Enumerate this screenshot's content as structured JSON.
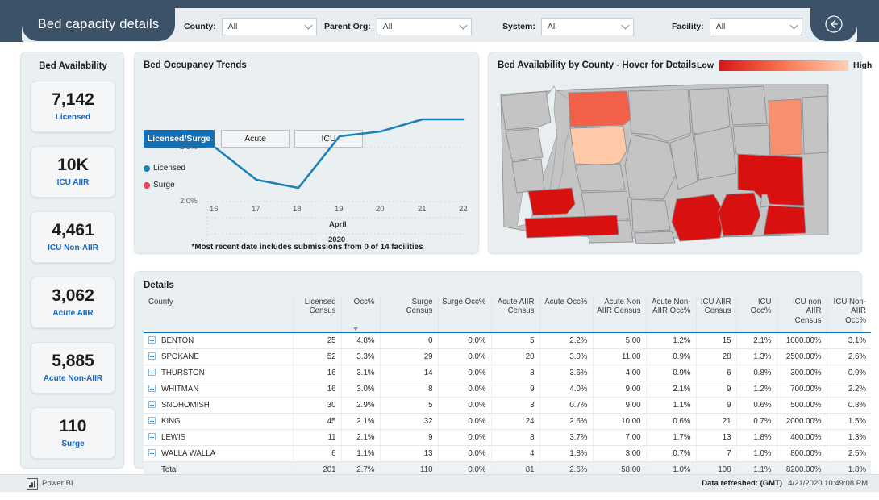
{
  "header": {
    "title": "Bed capacity details",
    "back_icon": "circle-left-arrow-icon",
    "slicers": [
      {
        "label": "County:",
        "value": "All",
        "caret": "chevron-down-icon"
      },
      {
        "label": "Parent Org:",
        "value": "All",
        "caret": "chevron-down-icon"
      },
      {
        "label": "System:",
        "value": "All",
        "caret": "chevron-down-icon"
      },
      {
        "label": "Facility:",
        "value": "All",
        "caret": "chevron-down-icon"
      }
    ]
  },
  "kpi": {
    "heading": "Bed Availability",
    "cards": [
      {
        "value": "7,142",
        "label": "Licensed"
      },
      {
        "value": "10K",
        "label": "ICU AIIR"
      },
      {
        "value": "4,461",
        "label": "ICU Non-AIIR"
      },
      {
        "value": "3,062",
        "label": "Acute AIIR"
      },
      {
        "value": "5,885",
        "label": "Acute Non-AIIR"
      },
      {
        "value": "110",
        "label": "Surge"
      }
    ]
  },
  "trends": {
    "title": "Bed Occupancy Trends",
    "tabs": [
      {
        "label": "Licensed/Surge",
        "active": true
      },
      {
        "label": "Acute",
        "active": false
      },
      {
        "label": "ICU",
        "active": false
      }
    ],
    "note": "*Most recent date includes submissions from 0 of 14 facilities"
  },
  "map": {
    "title": "Bed Availability by County - Hover for Details",
    "legend_low": "Low",
    "legend_high": "High",
    "legend_colors": {
      "low": "#d81717",
      "mid": "#f97652",
      "high": "#ffcfb4"
    },
    "county_fills": {
      "default": "#c4c4c4",
      "whatcom": "#f2604a",
      "skagit": "#ffc9a8",
      "grays_harbor": "#d81010",
      "lewis": "#d81010",
      "pend_oreille": "#fa8f6e",
      "spokane": "#d81010",
      "benton": "#d81010",
      "walla_walla": "#d81010",
      "whitman": "#d81010"
    }
  },
  "details": {
    "title": "Details",
    "columns": [
      "County",
      "Licensed Census",
      "Occ%",
      "Surge Census",
      "Surge Occ%",
      "Acute AIIR Census",
      "Acute Occ%",
      "Acute Non AIIR Census",
      "Acute Non-AIIR Occ%",
      "ICU AIIR Census",
      "ICU Occ%",
      "ICU non AIIR Census",
      "ICU Non-AIIR Occ%"
    ],
    "sorted_column": "Occ%",
    "sort_direction": "descending",
    "rows": [
      {
        "county": "BENTON",
        "licensed_census": "25",
        "occ": "4.8%",
        "surge_census": "0",
        "surge_occ": "0.0%",
        "acute_aiir_census": "5",
        "acute_occ": "2.2%",
        "acute_non_aiir_census": "5.00",
        "acute_non_aiir_occ": "1.2%",
        "icu_aiir_census": "15",
        "icu_occ": "2.1%",
        "icu_non_aiir_census": "1000.00%",
        "icu_non_aiir_occ": "3.1%"
      },
      {
        "county": "SPOKANE",
        "licensed_census": "52",
        "occ": "3.3%",
        "surge_census": "29",
        "surge_occ": "0.0%",
        "acute_aiir_census": "20",
        "acute_occ": "3.0%",
        "acute_non_aiir_census": "11.00",
        "acute_non_aiir_occ": "0.9%",
        "icu_aiir_census": "28",
        "icu_occ": "1.3%",
        "icu_non_aiir_census": "2500.00%",
        "icu_non_aiir_occ": "2.6%"
      },
      {
        "county": "THURSTON",
        "licensed_census": "16",
        "occ": "3.1%",
        "surge_census": "14",
        "surge_occ": "0.0%",
        "acute_aiir_census": "8",
        "acute_occ": "3.6%",
        "acute_non_aiir_census": "4.00",
        "acute_non_aiir_occ": "0.9%",
        "icu_aiir_census": "6",
        "icu_occ": "0.8%",
        "icu_non_aiir_census": "300.00%",
        "icu_non_aiir_occ": "0.9%"
      },
      {
        "county": "WHITMAN",
        "licensed_census": "16",
        "occ": "3.0%",
        "surge_census": "8",
        "surge_occ": "0.0%",
        "acute_aiir_census": "9",
        "acute_occ": "4.0%",
        "acute_non_aiir_census": "9.00",
        "acute_non_aiir_occ": "2.1%",
        "icu_aiir_census": "9",
        "icu_occ": "1.2%",
        "icu_non_aiir_census": "700.00%",
        "icu_non_aiir_occ": "2.2%"
      },
      {
        "county": "SNOHOMISH",
        "licensed_census": "30",
        "occ": "2.9%",
        "surge_census": "5",
        "surge_occ": "0.0%",
        "acute_aiir_census": "3",
        "acute_occ": "0.7%",
        "acute_non_aiir_census": "9.00",
        "acute_non_aiir_occ": "1.1%",
        "icu_aiir_census": "9",
        "icu_occ": "0.6%",
        "icu_non_aiir_census": "500.00%",
        "icu_non_aiir_occ": "0.8%"
      },
      {
        "county": "KING",
        "licensed_census": "45",
        "occ": "2.1%",
        "surge_census": "32",
        "surge_occ": "0.0%",
        "acute_aiir_census": "24",
        "acute_occ": "2.6%",
        "acute_non_aiir_census": "10.00",
        "acute_non_aiir_occ": "0.6%",
        "icu_aiir_census": "21",
        "icu_occ": "0.7%",
        "icu_non_aiir_census": "2000.00%",
        "icu_non_aiir_occ": "1.5%"
      },
      {
        "county": "LEWIS",
        "licensed_census": "11",
        "occ": "2.1%",
        "surge_census": "9",
        "surge_occ": "0.0%",
        "acute_aiir_census": "8",
        "acute_occ": "3.7%",
        "acute_non_aiir_census": "7.00",
        "acute_non_aiir_occ": "1.7%",
        "icu_aiir_census": "13",
        "icu_occ": "1.8%",
        "icu_non_aiir_census": "400.00%",
        "icu_non_aiir_occ": "1.3%"
      },
      {
        "county": "WALLA WALLA",
        "licensed_census": "6",
        "occ": "1.1%",
        "surge_census": "13",
        "surge_occ": "0.0%",
        "acute_aiir_census": "4",
        "acute_occ": "1.8%",
        "acute_non_aiir_census": "3.00",
        "acute_non_aiir_occ": "0.7%",
        "icu_aiir_census": "7",
        "icu_occ": "1.0%",
        "icu_non_aiir_census": "800.00%",
        "icu_non_aiir_occ": "2.5%"
      }
    ],
    "total_row": {
      "county": "Total",
      "licensed_census": "201",
      "occ": "2.7%",
      "surge_census": "110",
      "surge_occ": "0.0%",
      "acute_aiir_census": "81",
      "acute_occ": "2.6%",
      "acute_non_aiir_census": "58.00",
      "acute_non_aiir_occ": "1.0%",
      "icu_aiir_census": "108",
      "icu_occ": "1.1%",
      "icu_non_aiir_census": "8200.00%",
      "icu_non_aiir_occ": "1.8%"
    }
  },
  "footer": {
    "brand": "Power BI",
    "brand_icon": "power-bi-bars-icon",
    "refresh_label": "Data refreshed: (GMT)",
    "refresh_time": "4/21/2020 10:49:08 PM"
  },
  "chart_data": {
    "type": "line",
    "title": "Bed Occupancy Trends",
    "xlabel": "April 2020",
    "ylabel": "",
    "x": [
      "16",
      "17",
      "18",
      "19",
      "20",
      "21",
      "22"
    ],
    "x_axis_caption_line1": "April",
    "x_axis_caption_line2": "2020",
    "ytick_labels": [
      "2.0%",
      "2.5%"
    ],
    "ylim": [
      1.95,
      2.95
    ],
    "grid": true,
    "legend_position": "left",
    "series": [
      {
        "name": "Licensed",
        "color": "#1b80b8",
        "values": [
          2.5,
          2.17,
          2.11,
          2.66,
          2.69,
          2.78,
          2.78
        ]
      },
      {
        "name": "Surge",
        "color": "#e8414f",
        "values": [
          null,
          null,
          null,
          null,
          null,
          null,
          null
        ]
      }
    ]
  }
}
